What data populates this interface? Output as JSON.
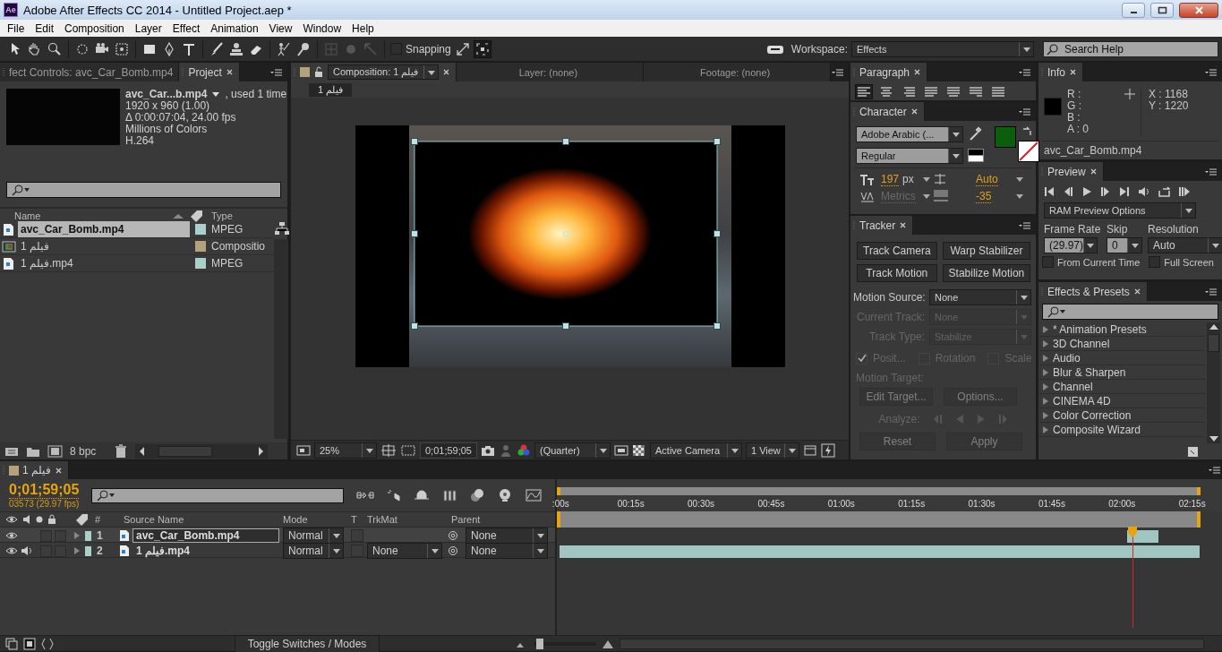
{
  "window": {
    "logo": "Ae",
    "title": "Adobe After Effects CC 2014 - Untitled Project.aep *"
  },
  "menu": [
    "File",
    "Edit",
    "Composition",
    "Layer",
    "Effect",
    "Animation",
    "View",
    "Window",
    "Help"
  ],
  "toolbar": {
    "snapping": {
      "label": "Snapping",
      "checked": false
    },
    "workspace_label": "Workspace:",
    "workspace": "Effects",
    "search": {
      "placeholder": "Search Help"
    }
  },
  "project": {
    "tabs": [
      {
        "label": "fect Controls: avc_Car_Bomb.mp4",
        "selected": false
      },
      {
        "label": "Project",
        "selected": true
      }
    ],
    "preview_title": "avc_Car...b.mp4",
    "preview_usage": ", used 1 time",
    "preview_details": [
      "1920 x 960 (1.00)",
      "Δ 0:00:07:04, 24.00 fps",
      "Millions of Colors",
      "H.264"
    ],
    "columns": [
      "Name",
      "Type"
    ],
    "items": [
      {
        "name": "avc_Car_Bomb.mp4",
        "kind": "footage",
        "color": "#a9d0cb",
        "type": "MPEG",
        "selected": true
      },
      {
        "name": "فيلم 1",
        "kind": "composition",
        "color": "#b4a27c",
        "type": "Compositio",
        "selected": false
      },
      {
        "name": "فيلم 1.mp4",
        "kind": "footage",
        "color": "#a9d0cb",
        "type": "MPEG",
        "selected": false
      }
    ],
    "bit_depth": "8 bpc"
  },
  "composition": {
    "tabs": [
      {
        "label": "Composition: فيلم 1",
        "selected": true
      },
      {
        "label": "Layer: (none)",
        "selected": false
      },
      {
        "label": "Footage: (none)",
        "selected": false
      }
    ],
    "breadcrumb": "فيلم 1",
    "zoom": "25%",
    "timecode": "0;01;59;05",
    "resolution": "(Quarter)",
    "camera": "Active Camera",
    "views": "1 View"
  },
  "paragraph": {
    "title": "Paragraph",
    "align": [
      {
        "kind": "left",
        "selected": true
      },
      {
        "kind": "center",
        "selected": false
      },
      {
        "kind": "right",
        "selected": false
      },
      {
        "kind": "justify-left",
        "selected": false
      },
      {
        "kind": "justify-center",
        "selected": false
      },
      {
        "kind": "justify-right",
        "selected": false
      },
      {
        "kind": "justify-all",
        "selected": false
      }
    ]
  },
  "character": {
    "title": "Character",
    "font": "Adobe Arabic (...",
    "style": "Regular",
    "size": "197",
    "size_unit": "px",
    "leading": "Auto",
    "kerning": "Metrics",
    "tracking": "-35"
  },
  "tracker": {
    "title": "Tracker",
    "buttons": [
      {
        "label": "Track Camera",
        "disabled": false
      },
      {
        "label": "Warp Stabilizer",
        "disabled": false
      },
      {
        "label": "Track Motion",
        "disabled": false
      },
      {
        "label": "Stabilize Motion",
        "disabled": false
      }
    ],
    "fields": [
      {
        "label": "Motion Source:",
        "value": "None",
        "disabled": false
      },
      {
        "label": "Current Track:",
        "value": "None",
        "disabled": true
      },
      {
        "label": "Track Type:",
        "value": "Stabilize",
        "disabled": true
      }
    ],
    "options": [
      {
        "label": "Posit...",
        "checked": true,
        "disabled": true
      },
      {
        "label": "Rotation",
        "checked": false,
        "disabled": true
      },
      {
        "label": "Scale",
        "checked": false,
        "disabled": true
      }
    ],
    "motion_target": "Motion Target:",
    "target_buttons": [
      {
        "label": "Edit Target...",
        "disabled": true
      },
      {
        "label": "Options...",
        "disabled": true
      }
    ],
    "analyze": "Analyze:",
    "bottom_buttons": [
      {
        "label": "Reset",
        "disabled": true
      },
      {
        "label": "Apply",
        "disabled": true
      }
    ]
  },
  "info": {
    "title": "Info",
    "channels": [
      "R :",
      "G :",
      "B :",
      "A : 0"
    ],
    "x": "X : 1168",
    "y": "Y : 1220",
    "source": "avc_Car_Bomb.mp4"
  },
  "preview": {
    "title": "Preview",
    "options": "RAM Preview Options",
    "frame_rate": {
      "label": "Frame Rate",
      "value": "(29.97)"
    },
    "skip": {
      "label": "Skip",
      "value": "0"
    },
    "resolution": {
      "label": "Resolution",
      "value": "Auto"
    },
    "checks": [
      {
        "label": "From Current Time",
        "checked": false
      },
      {
        "label": "Full Screen",
        "checked": false
      }
    ]
  },
  "effects": {
    "title": "Effects & Presets",
    "categories": [
      {
        "label": "* Animation Presets",
        "expanded": false
      },
      {
        "label": "3D Channel",
        "expanded": false
      },
      {
        "label": "Audio",
        "expanded": false
      },
      {
        "label": "Blur & Sharpen",
        "expanded": false
      },
      {
        "label": "Channel",
        "expanded": false
      },
      {
        "label": "CINEMA 4D",
        "expanded": false
      },
      {
        "label": "Color Correction",
        "expanded": false
      },
      {
        "label": "Composite Wizard",
        "expanded": false
      }
    ]
  },
  "timeline": {
    "tab": "فيلم 1",
    "timecode": "0;01;59;05",
    "frame_info": "03573 (29.97 fps)",
    "columns": [
      "#",
      "Source Name",
      "Mode",
      "T",
      "TrkMat",
      "Parent"
    ],
    "layers": [
      {
        "number": "1",
        "name": "avc_Car_Bomb.mp4",
        "mode": "Normal",
        "parent": "None",
        "audio": false,
        "selected": true
      },
      {
        "number": "2",
        "name": "فيلم 1.mp4",
        "mode": "Normal",
        "trkmat": "None",
        "parent": "None",
        "audio": true,
        "selected": false
      }
    ],
    "ruler": [
      ":00s",
      "00:15s",
      "00:30s",
      "00:45s",
      "01:00s",
      "01:15s",
      "01:30s",
      "01:45s",
      "02:00s",
      "02:15s"
    ],
    "playhead": {
      "level": 0.866
    },
    "toggle": "Toggle Switches / Modes",
    "zoom": {
      "level": 0.1
    }
  }
}
